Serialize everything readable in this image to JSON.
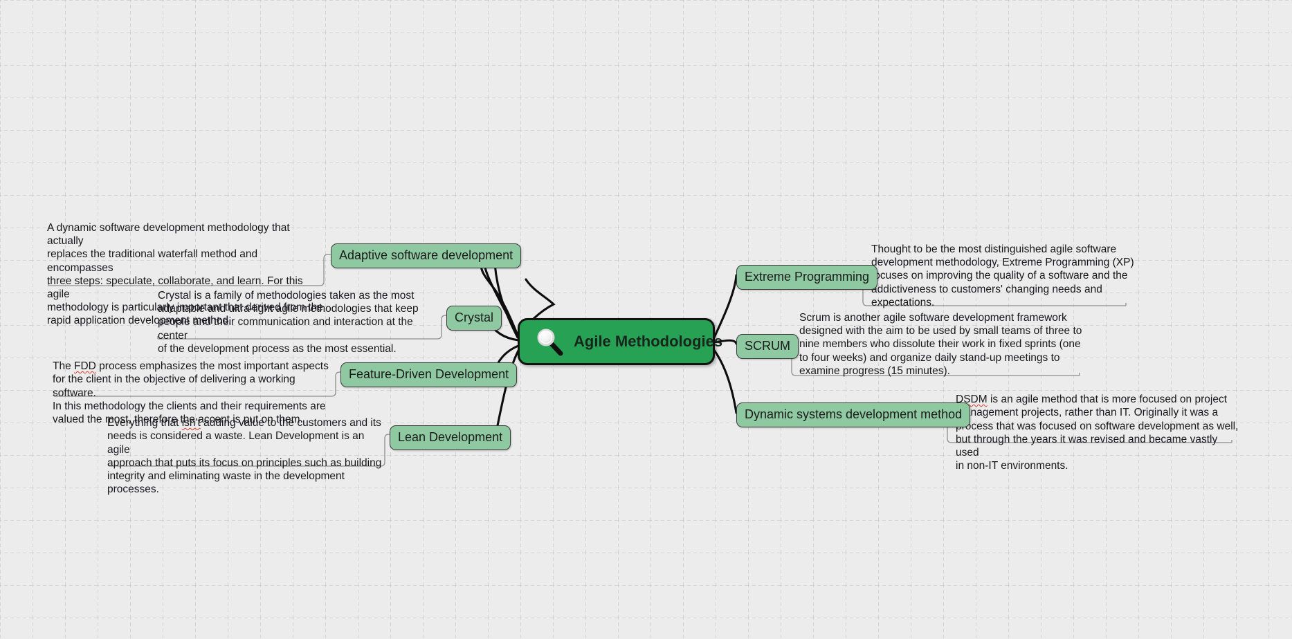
{
  "diagram": {
    "type": "mind-map",
    "title": "Agile Methodologies",
    "background_color": "#ececec",
    "grid": "dashed",
    "central_node_color": "#27a254",
    "branch_node_color": "#8fc9a1",
    "central_icon": "magnifier-icon"
  },
  "central": {
    "label": "Agile Methodologies"
  },
  "branches": [
    {
      "id": "adaptive-software-development",
      "label": "Adaptive software development",
      "note": "A dynamic software development methodology that actually replaces the traditional waterfall method and encompasses three steps: speculate, collaborate, and learn. For this agile methodology is particularly important that derived from the rapid application development method.",
      "side": "left"
    },
    {
      "id": "crystal",
      "label": "Crystal",
      "note": "Crystal is a family of methodologies taken as the most adaptable and ultra-light agile methodologies that keep people and their communication and interaction at the center of the development process as the most essential.",
      "side": "left"
    },
    {
      "id": "feature-driven-development",
      "label": "Feature-Driven Development",
      "note": "The FDD process emphasizes the most important aspects for the client in the objective of delivering a working software. In this methodology the clients and their requirements are valued the most, therefore the accent is put on them.",
      "misspelled": "FDD",
      "side": "left"
    },
    {
      "id": "lean-development",
      "label": "Lean Development",
      "note": "Everything that isn't adding value to the customers and its needs is considered a waste. Lean Development is an agile approach that puts its focus on principles such as building integrity and eliminating waste in the development processes.",
      "misspelled": "isn't",
      "side": "left"
    },
    {
      "id": "extreme-programming",
      "label": "Extreme Programming",
      "note": "Thought to be the most distinguished agile software development methodology, Extreme Programming (XP) focuses on improving the quality of a software and the addictiveness to customers' changing needs and expectations.",
      "side": "right"
    },
    {
      "id": "scrum",
      "label": "SCRUM",
      "note": "Scrum is another agile software development framework designed with the aim to be used by small teams of three to nine members who dissolute their work in fixed sprints (one to four weeks) and organize daily stand-up meetings to examine progress (15 minutes).",
      "side": "right"
    },
    {
      "id": "dynamic-systems-development-method",
      "label": "Dynamic systems development method",
      "note": "DSDM is an agile method that is more focused on project management projects, rather than IT. Originally it was a process that was focused on software development as well, but through the years it was revised and became vastly used in non-IT environments.",
      "misspelled": "DSDM",
      "side": "right"
    }
  ],
  "notes_lines": {
    "adaptive": "A dynamic software development methodology that actually\nreplaces the traditional waterfall method and encompasses\nthree steps: speculate, collaborate, and learn. For this agile\nmethodology is particularly important that derived from the\nrapid application development method.",
    "crystal": "Crystal is a family of methodologies taken as the most\nadaptable and ultra-light agile methodologies that keep\npeople and their communication and interaction at the center\nof the development process as the most essential.",
    "fdd_rest": " process emphasizes the most important aspects\nfor the client in the objective of delivering a working software.\nIn this methodology the clients and their requirements are\nvalued the most, therefore the accent is put on them.",
    "fdd_head": "The ",
    "lean_head": "Everything that ",
    "lean_rest": " adding value to the customers and its\nneeds is considered a waste. Lean Development is an agile\napproach that puts its focus on principles such as building\nintegrity and eliminating waste in the development\nprocesses.",
    "xp": "Thought to be the most distinguished agile software\ndevelopment methodology, Extreme Programming (XP)\nfocuses on improving the quality of a software and the\naddictiveness to customers' changing needs and\nexpectations.",
    "scrum": "Scrum is another agile software development framework\ndesigned with the aim to be used by small teams of three to\nnine members who dissolute their work in fixed sprints (one\nto four weeks) and organize daily stand-up meetings to\nexamine progress (15 minutes).",
    "dsdm_rest": " is an agile method that is more focused on project\nmanagement projects, rather than IT. Originally it was a\nprocess that was focused on software development as well,\nbut through the years it was revised and became vastly used\nin non-IT environments.",
    "dsdm_head": ""
  },
  "misspellings": {
    "fdd": "FDD",
    "lean": "isn't",
    "dsdm": "DSDM"
  }
}
